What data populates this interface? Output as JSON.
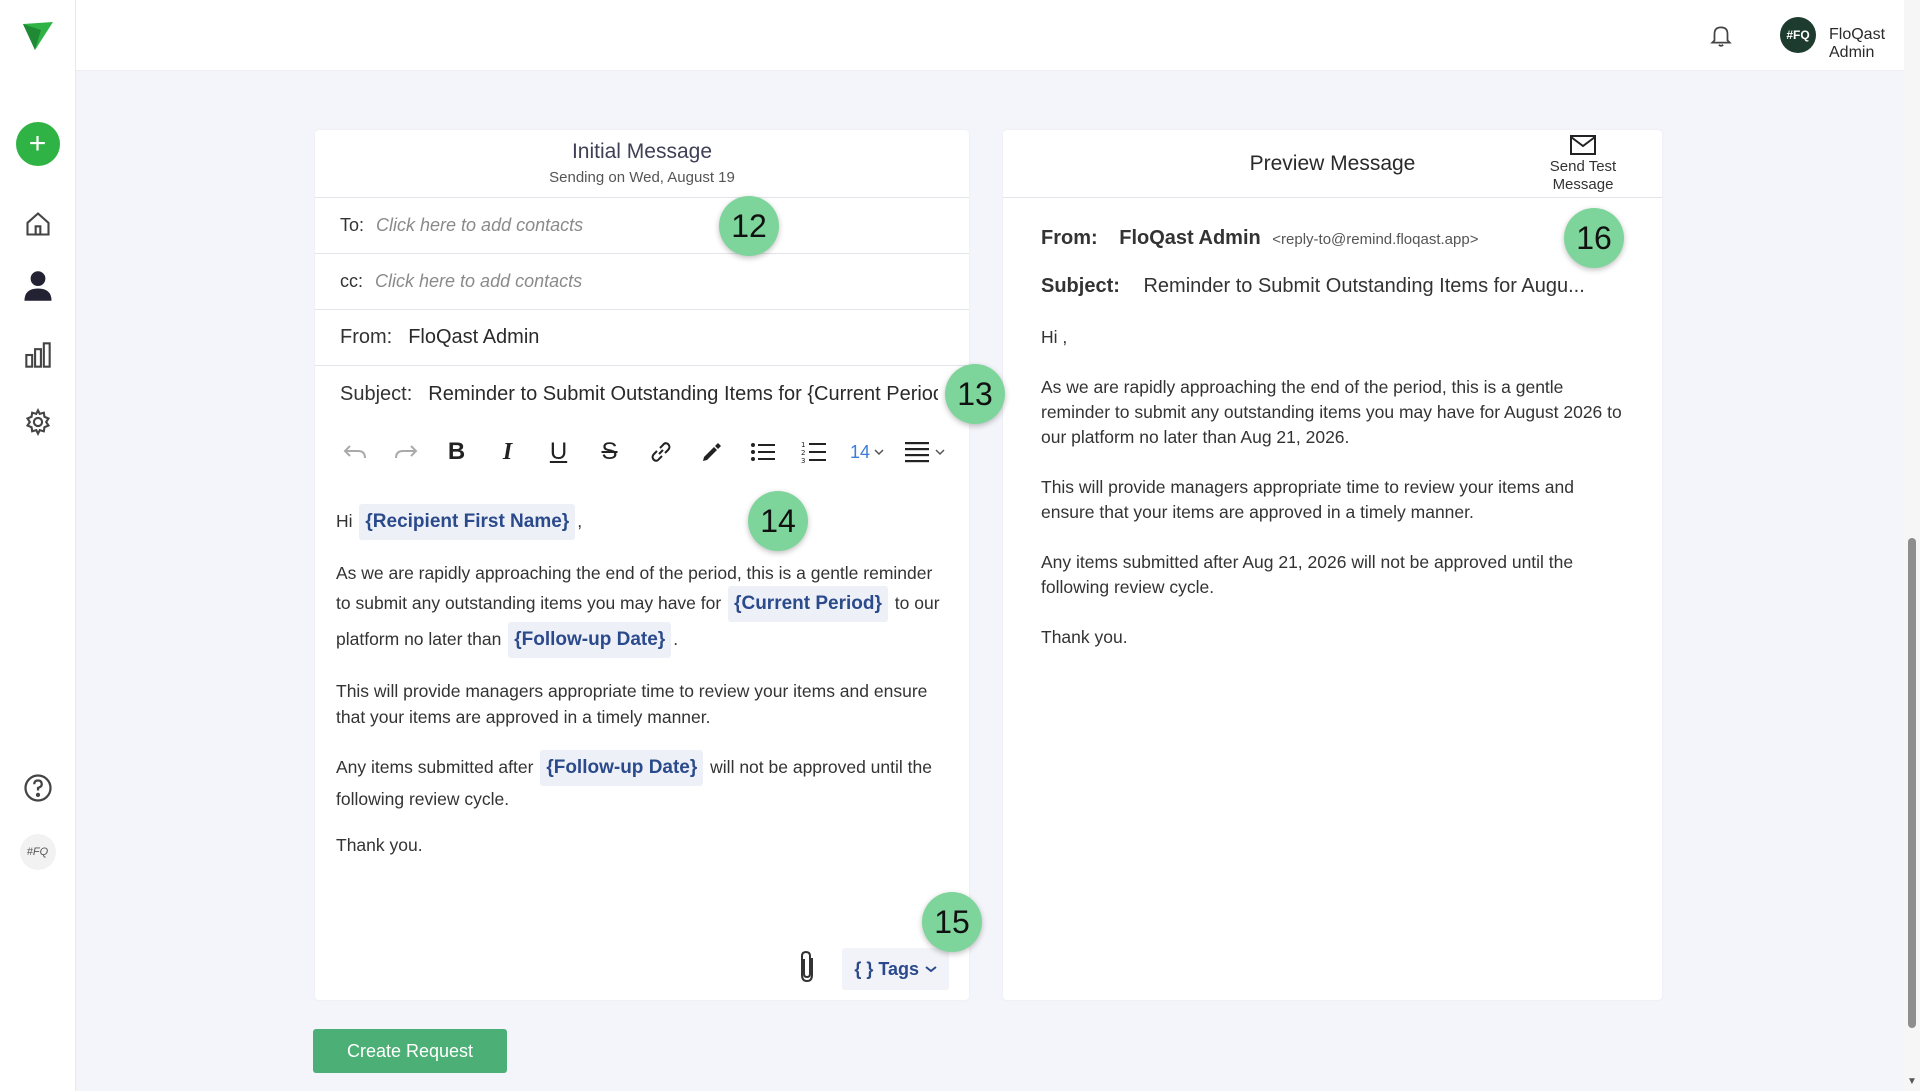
{
  "header": {
    "notifications_icon": "bell-icon",
    "user_initials": "#FQ",
    "user_name": "FloQast Admin"
  },
  "sidebar": {
    "add_label": "+",
    "items": [
      "home-icon",
      "user-icon",
      "chart-icon",
      "gear-icon"
    ],
    "help_icon": "help-icon",
    "brand_badge": "#FQ"
  },
  "compose": {
    "title": "Initial Message",
    "subtitle": "Sending on Wed, August 19",
    "to_label": "To:",
    "to_placeholder": "Click here to add contacts",
    "cc_label": "cc:",
    "cc_placeholder": "Click here to add contacts",
    "from_label": "From:",
    "from_value": "FloQast Admin",
    "subject_label": "Subject:",
    "subject_value": "Reminder to Submit Outstanding Items for {Current Period}",
    "font_size": "14",
    "body": {
      "greeting_pre": "Hi",
      "tag_recipient": "{Recipient First Name}",
      "greeting_post": ",",
      "p1_a": "As we are rapidly approaching the end of the period, this is a gentle reminder to submit any outstanding items you may have for",
      "tag_period": "{Current Period}",
      "p1_b": "to our platform no later than",
      "tag_followup": "{Follow-up Date}",
      "p1_c": ".",
      "p2": "This will provide managers appropriate time to review your items and ensure that your items are approved in a timely manner.",
      "p3_a": "Any items submitted after",
      "p3_b": "will not be approved until the following review cycle.",
      "p4": "Thank you."
    },
    "tags_label": "{ } Tags"
  },
  "preview": {
    "title": "Preview Message",
    "send_test_label": "Send Test Message",
    "from_label": "From:",
    "from_name": "FloQast Admin",
    "from_address": "<reply-to@remind.floqast.app>",
    "subject_label": "Subject:",
    "subject_value": "Reminder to Submit Outstanding Items for Augu...",
    "greeting": "Hi ,",
    "p1": "As we are rapidly approaching the end of the period, this is a gentle reminder to submit any outstanding items you may have for August 2026 to our platform no later than Aug 21, 2026.",
    "p2": "This will provide managers appropriate time to review your items and ensure that your items are approved in a timely manner.",
    "p3": "Any items submitted after Aug 21, 2026 will not be approved until the following review cycle.",
    "p4": "Thank you."
  },
  "actions": {
    "create_label": "Create Request"
  },
  "badges": {
    "b12": "12",
    "b13": "13",
    "b14": "14",
    "b15": "15",
    "b16": "16"
  },
  "colors": {
    "accent_green": "#2fb344",
    "button_green": "#4caf75",
    "badge_green": "#7ed59b",
    "tag_blue": "#2b4a8c"
  }
}
